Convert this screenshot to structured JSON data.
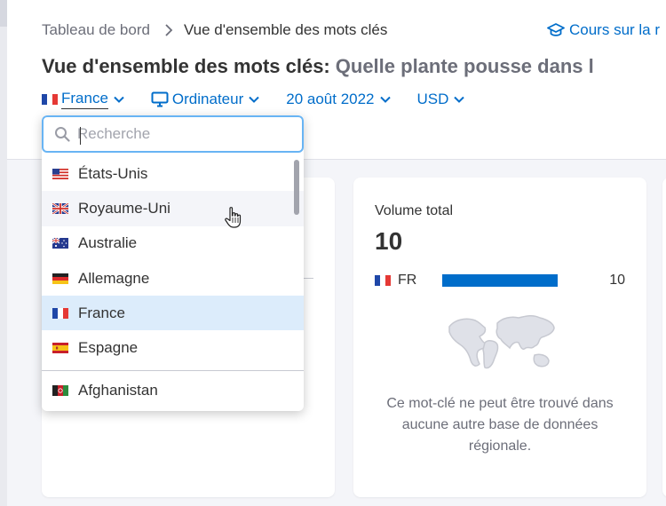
{
  "breadcrumb": {
    "home": "Tableau de bord",
    "current": "Vue d'ensemble des mots clés"
  },
  "course_link": "Cours sur la r",
  "title": {
    "main": "Vue d'ensemble des mots clés:",
    "query": "Quelle plante pousse dans l"
  },
  "filters": {
    "country": "France",
    "device": "Ordinateur",
    "date": "20 août 2022",
    "currency": "USD"
  },
  "search": {
    "placeholder": "Recherche",
    "value": ""
  },
  "countries": [
    {
      "name": "États-Unis",
      "flag": "us-flag-icon"
    },
    {
      "name": "Royaume-Uni",
      "flag": "uk-flag-icon"
    },
    {
      "name": "Australie",
      "flag": "australia-flag-icon"
    },
    {
      "name": "Allemagne",
      "flag": "germany-flag-icon"
    },
    {
      "name": "France",
      "flag": "france-flag-icon"
    },
    {
      "name": "Espagne",
      "flag": "spain-flag-icon"
    },
    {
      "name": "Afghanistan",
      "flag": "afghanistan-flag-icon"
    }
  ],
  "volume_card": {
    "label": "Volume total",
    "value": "10",
    "row": {
      "country_code": "FR",
      "value": "10"
    },
    "empty_message": "Ce mot-clé ne peut être trouvé dans aucune autre base de données régionale."
  },
  "colors": {
    "accent": "#006dca",
    "selected_bg": "#dcecfb",
    "focus_border": "#68b4f4"
  }
}
